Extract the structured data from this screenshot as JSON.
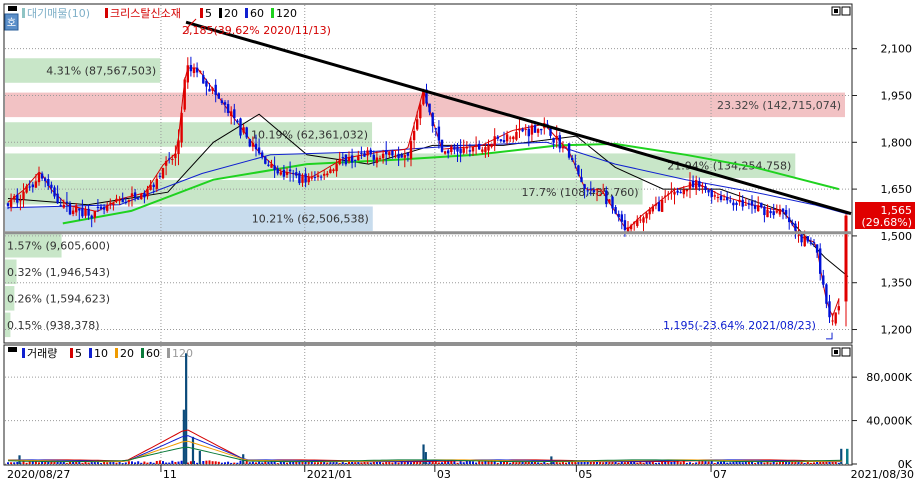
{
  "chart_data": {
    "type": "candlestick",
    "price_panel": {
      "legend": {
        "sync_icon": "호",
        "pf_label": "대기매물(10)",
        "name": "크리스탈신소재",
        "ma": [
          {
            "label": "5",
            "color": "#d40000"
          },
          {
            "label": "20",
            "color": "#000000"
          },
          {
            "label": "60",
            "color": "#1020d0"
          },
          {
            "label": "120",
            "color": "#1fd21f"
          }
        ]
      },
      "y_ticks": [
        {
          "value": 2100,
          "label": "2,100"
        },
        {
          "value": 1950,
          "label": "1,950"
        },
        {
          "value": 1800,
          "label": "1,800"
        },
        {
          "value": 1650,
          "label": "1,650"
        },
        {
          "value": 1500,
          "label": "1,500"
        },
        {
          "value": 1350,
          "label": "1,350"
        },
        {
          "value": 1200,
          "label": "1,200"
        }
      ],
      "ylim": [
        1160,
        2240
      ],
      "current": {
        "value": 1565,
        "price_label": "1,565",
        "change_label": "(29.68%)"
      },
      "annotations": {
        "high": "2,185(39.62% 2020/11/13)",
        "low": "1,195(-23.64% 2021/08/23)"
      },
      "volume_profile": [
        {
          "price": 2030,
          "pct": "4.31%",
          "vol": "(87,567,503)",
          "label": "4.31% (87,567,503)",
          "color": "#c8e6c8"
        },
        {
          "price": 1920,
          "pct": "23.32%",
          "vol": "(142,715,074)",
          "label": "23.32% (142,715,074)",
          "color": "#f2c2c4"
        },
        {
          "price": 1825,
          "pct": "10.19%",
          "vol": "(62,361,032)",
          "label": "10.19% (62,361,032)",
          "color": "#c8e6c8"
        },
        {
          "price": 1725,
          "pct": "21.94%",
          "vol": "(134,254,758)",
          "label": "21.94% (134,254,758)",
          "color": "#c8e6c8"
        },
        {
          "price": 1640,
          "pct": "17.7%",
          "vol": "(108,485,760)",
          "label": "17.7% (108,485,760)",
          "color": "#c8e6c8"
        },
        {
          "price": 1555,
          "pct": "10.21%",
          "vol": "(62,506,538)",
          "label": "10.21% (62,506,538)",
          "color": "#c8dced"
        },
        {
          "price": 1470,
          "pct": "1.57%",
          "vol": "(9,605,600)",
          "label": "1.57% (9,605,600)",
          "color": "#c8e6c8"
        },
        {
          "price": 1385,
          "pct": "0.32%",
          "vol": "(1,946,543)",
          "label": "0.32% (1,946,543)",
          "color": "#c8e6c8"
        },
        {
          "price": 1300,
          "pct": "0.26%",
          "vol": "(1,594,623)",
          "label": "0.26% (1,594,623)",
          "color": "#c8e6c8"
        },
        {
          "price": 1215,
          "pct": "0.15%",
          "vol": "(938,378)",
          "label": "0.15% (938,378)",
          "color": "#c8e6c8"
        }
      ],
      "trendline": [
        {
          "date": "2020/11/13",
          "price": 2185
        },
        {
          "date": "2021/08/30",
          "price": 1565
        }
      ],
      "support_price": 1510
    },
    "volume_panel": {
      "legend": {
        "title": "거래량",
        "ma": [
          {
            "label": "5",
            "color": "#d40000"
          },
          {
            "label": "10",
            "color": "#1020d0"
          },
          {
            "label": "20",
            "color": "#ee9a00"
          },
          {
            "label": "60",
            "color": "#0a7a3a"
          },
          {
            "label": "120",
            "color": "#9a9a9a"
          }
        ]
      },
      "y_ticks": [
        {
          "value": 80000,
          "label": "80,000K"
        },
        {
          "value": 40000,
          "label": "40,000K"
        },
        {
          "value": 0,
          "label": "0K"
        }
      ],
      "ylim": [
        0,
        105000
      ],
      "peak_volume_k": 102000
    },
    "x_axis": {
      "labels": [
        {
          "date": "2020/08/27",
          "label": "2020/08/27"
        },
        {
          "date": "2020/11/02",
          "label": "11"
        },
        {
          "date": "2021/01/04",
          "label": "2021/01"
        },
        {
          "date": "2021/03/02",
          "label": "03"
        },
        {
          "date": "2021/05/03",
          "label": "05"
        },
        {
          "date": "2021/07/01",
          "label": "07"
        },
        {
          "date": "2021/08/30",
          "label": "2021/08/30"
        }
      ],
      "start": "2020/08/27",
      "end": "2021/08/30"
    },
    "price_path": [
      [
        "2020/08/27",
        1600
      ],
      [
        "2020/09/03",
        1640
      ],
      [
        "2020/09/10",
        1700
      ],
      [
        "2020/09/15",
        1640
      ],
      [
        "2020/09/22",
        1590
      ],
      [
        "2020/10/05",
        1570
      ],
      [
        "2020/10/15",
        1610
      ],
      [
        "2020/10/26",
        1630
      ],
      [
        "2020/11/03",
        1720
      ],
      [
        "2020/11/09",
        1760
      ],
      [
        "2020/11/13",
        2030
      ],
      [
        "2020/11/18",
        2030
      ],
      [
        "2020/11/26",
        1950
      ],
      [
        "2020/12/04",
        1870
      ],
      [
        "2020/12/15",
        1760
      ],
      [
        "2020/12/24",
        1700
      ],
      [
        "2021/01/07",
        1680
      ],
      [
        "2021/01/21",
        1740
      ],
      [
        "2021/02/05",
        1760
      ],
      [
        "2021/02/18",
        1770
      ],
      [
        "2021/02/25",
        1960
      ],
      [
        "2021/03/05",
        1770
      ],
      [
        "2021/03/22",
        1780
      ],
      [
        "2021/04/05",
        1830
      ],
      [
        "2021/04/19",
        1850
      ],
      [
        "2021/04/30",
        1760
      ],
      [
        "2021/05/07",
        1640
      ],
      [
        "2021/05/14",
        1640
      ],
      [
        "2021/05/25",
        1510
      ],
      [
        "2021/06/01",
        1560
      ],
      [
        "2021/06/15",
        1640
      ],
      [
        "2021/06/25",
        1660
      ],
      [
        "2021/07/06",
        1620
      ],
      [
        "2021/07/20",
        1590
      ],
      [
        "2021/08/02",
        1570
      ],
      [
        "2021/08/09",
        1490
      ],
      [
        "2021/08/16",
        1470
      ],
      [
        "2021/08/20",
        1300
      ],
      [
        "2021/08/23",
        1230
      ],
      [
        "2021/08/26",
        1290
      ],
      [
        "2021/08/30",
        1565
      ]
    ],
    "ma_paths": {
      "ma20": [
        [
          "2020/08/27",
          1620
        ],
        [
          "2020/10/01",
          1600
        ],
        [
          "2020/11/05",
          1640
        ],
        [
          "2020/11/25",
          1800
        ],
        [
          "2020/12/15",
          1890
        ],
        [
          "2021/01/05",
          1760
        ],
        [
          "2021/02/01",
          1730
        ],
        [
          "2021/03/01",
          1790
        ],
        [
          "2021/04/01",
          1790
        ],
        [
          "2021/05/03",
          1820
        ],
        [
          "2021/05/20",
          1720
        ],
        [
          "2021/06/10",
          1650
        ],
        [
          "2021/07/05",
          1650
        ],
        [
          "2021/08/01",
          1580
        ],
        [
          "2021/08/20",
          1430
        ],
        [
          "2021/08/30",
          1370
        ]
      ],
      "ma60": [
        [
          "2020/08/27",
          1590
        ],
        [
          "2020/10/15",
          1600
        ],
        [
          "2020/11/20",
          1700
        ],
        [
          "2020/12/20",
          1760
        ],
        [
          "2021/02/01",
          1770
        ],
        [
          "2021/03/15",
          1790
        ],
        [
          "2021/04/20",
          1800
        ],
        [
          "2021/05/20",
          1730
        ],
        [
          "2021/06/20",
          1680
        ],
        [
          "2021/07/20",
          1640
        ],
        [
          "2021/08/15",
          1600
        ],
        [
          "2021/08/30",
          1570
        ]
      ],
      "ma120": [
        [
          "2020/09/20",
          1540
        ],
        [
          "2020/10/20",
          1580
        ],
        [
          "2020/11/25",
          1680
        ],
        [
          "2021/01/05",
          1730
        ],
        [
          "2021/02/15",
          1745
        ],
        [
          "2021/03/20",
          1760
        ],
        [
          "2021/04/25",
          1790
        ],
        [
          "2021/05/20",
          1795
        ],
        [
          "2021/06/20",
          1760
        ],
        [
          "2021/07/20",
          1720
        ],
        [
          "2021/08/10",
          1680
        ],
        [
          "2021/08/26",
          1650
        ]
      ]
    },
    "volume_spikes": [
      [
        "2020/09/01",
        8000
      ],
      [
        "2020/11/12",
        50000
      ],
      [
        "2020/11/13",
        102000
      ],
      [
        "2020/11/16",
        25000
      ],
      [
        "2020/11/19",
        12000
      ],
      [
        "2020/12/08",
        9000
      ],
      [
        "2021/02/25",
        18000
      ],
      [
        "2021/02/26",
        11000
      ],
      [
        "2021/04/22",
        7000
      ],
      [
        "2021/08/27",
        14000
      ]
    ]
  }
}
